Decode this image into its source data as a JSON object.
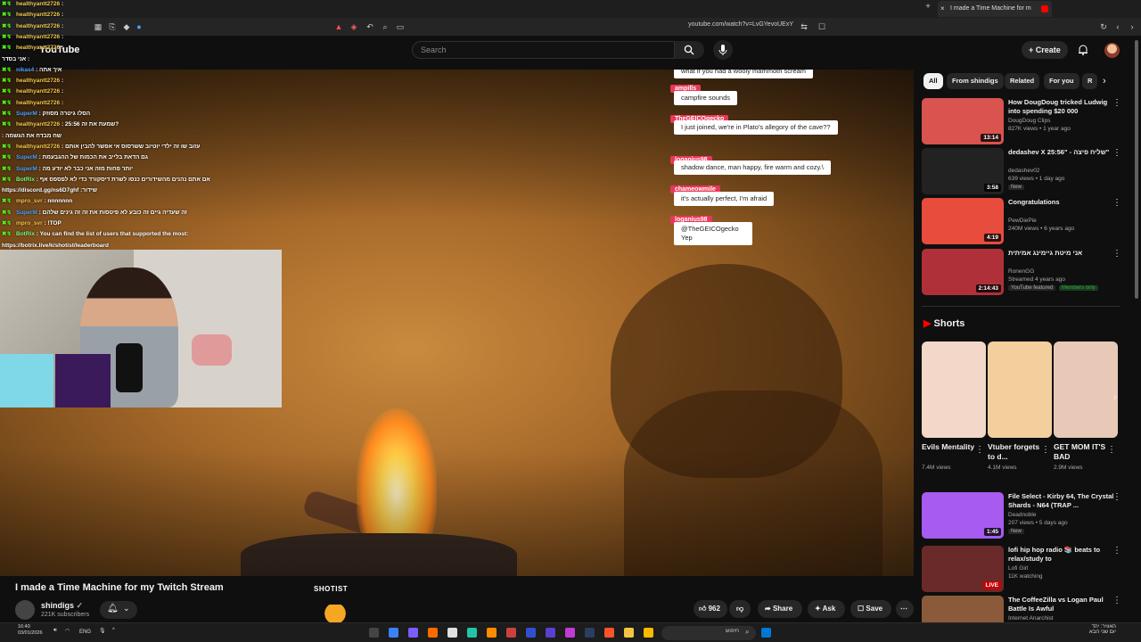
{
  "browser": {
    "tab_title": "I made a Time Machine for m",
    "tab_close": "×",
    "new_tab": "+",
    "url": "youtube.com/watch?v=LvGYevoUExY"
  },
  "youtube": {
    "logo": "YouTube",
    "search_placeholder": "Search",
    "create_label": "Create"
  },
  "chat_overlay": [
    {
      "user": "healthyantt2726",
      "msg": ":",
      "color": "yellow"
    },
    {
      "user": "healthyantt2726",
      "msg": ":",
      "color": "yellow"
    },
    {
      "user": "healthyantt2726",
      "msg": ":",
      "color": "yellow"
    },
    {
      "user": "healthyantt2726",
      "msg": ":",
      "color": "yellow"
    },
    {
      "user": "healthyantt2726",
      "msg": ":",
      "color": "yellow"
    },
    {
      "user": "",
      "msg": "אני בסדר :",
      "color": "yellow"
    },
    {
      "user": "nikas4",
      "msg": ": איך אתה",
      "color": "blue"
    },
    {
      "user": "healthyantt2726",
      "msg": ":",
      "color": "yellow"
    },
    {
      "user": "healthyantt2726",
      "msg": ":",
      "color": "yellow"
    },
    {
      "user": "healthyantt2726",
      "msg": ":",
      "color": "yellow"
    },
    {
      "user": "SuperM",
      "msg": ": הסלו גיטרה מסוזק",
      "color": "blue"
    },
    {
      "user": "healthyantt2726",
      "msg": ": 25:56 שמעת את זה?",
      "color": "yellow"
    },
    {
      "user": "",
      "msg": ": שח מבדח את הגשמה",
      "color": "red"
    },
    {
      "user": "healthyantt2726",
      "msg": ": עזוב שו זה ילדי יוטיוב ששרסוס אי אפשר להבין אותם",
      "color": "yellow"
    },
    {
      "user": "SuperM",
      "msg": ": גם הדאת בלייב את הכמות של ההגבעמת",
      "color": "blue"
    },
    {
      "user": "SuperM",
      "msg": ": יותר פחות מזה אני כבר לא יודע מה",
      "color": "blue"
    },
    {
      "user": "BotRix",
      "msg": ": אם אתם נהנים מהשידורים כנסו לשרת דיסקורד כדי לא לפספס אף",
      "color": "green"
    },
    {
      "user": "",
      "msg": "https://discord.gg/ns6D7ghf :שידור",
      "color": "yellow"
    },
    {
      "user": "mpro_svr",
      "msg": ": nnnnnnn",
      "color": "yellow"
    },
    {
      "user": "SuperM",
      "msg": ": זה שעדיה גיים זה כובע לא פיטסות את זה זה גינים שלהם",
      "color": "blue"
    },
    {
      "user": "mpro_svr",
      "msg": ": !TOP",
      "color": "yellow"
    },
    {
      "user": "BotRix",
      "msg": ": You can find the list of users that supported the most:",
      "color": "green"
    },
    {
      "user": "",
      "msg": "https://botrix.live/k/shotist/leaderboard",
      "color": "yellow"
    }
  ],
  "game_chat": [
    {
      "name": "",
      "msg": "what if you had a wooly mammoth scream"
    },
    {
      "name": "ampills",
      "msg": "campfire sounds"
    },
    {
      "name": "TheGEICOgecko",
      "msg": "I just joined, we're in Plato's allegory of the cave??"
    },
    {
      "name": "loganius98",
      "msg": "shadow dance, man happy, fire warm and cozy.\\"
    },
    {
      "name": "chameowmile",
      "msg": "it's actually perfect, I'm afraid"
    },
    {
      "name": "loganius98",
      "msg": "@TheGEICOgecko Yep"
    }
  ],
  "overlay_label": "SHOTIST",
  "video": {
    "title": "I made a Time Machine for my Twitch Stream",
    "channel": "shindigs",
    "subscribers": "221K subscribers",
    "likes": "962",
    "share": "Share",
    "ask": "Ask",
    "save": "Save"
  },
  "chips": [
    "All",
    "From shindigs",
    "Related",
    "For you",
    "R"
  ],
  "recommendations": [
    {
      "title": "How DougDoug tricked Ludwig into spending $20 000",
      "channel": "DougDoug Clips",
      "meta": "827K views • 1 year ago",
      "duration": "13:14",
      "badge": ""
    },
    {
      "title": "dedashev X שליח פיצה - \"25:56\"",
      "channel": "dedashev02",
      "meta": "639 views • 1 day ago",
      "duration": "3:58",
      "badge": "New"
    },
    {
      "title": "Congratulations",
      "channel": "PewDiePie",
      "meta": "240M views • 6 years ago",
      "duration": "4:19",
      "badge": ""
    },
    {
      "title": "אני מיטת גיימינג אמיתית",
      "channel": "RonenGG",
      "meta": "Streamed 4 years ago",
      "duration": "2:14:43",
      "badge": "YouTube featured",
      "badge2": "Members only"
    }
  ],
  "shorts": {
    "heading": "Shorts",
    "items": [
      {
        "title": "Evils Mentality",
        "views": "7.4M views"
      },
      {
        "title": "Vtuber forgets to d...",
        "views": "4.1M views"
      },
      {
        "title": "GET MOM IT'S BAD",
        "views": "2.9M views"
      }
    ]
  },
  "recommendations2": [
    {
      "title": "File Select - Kirby 64, The Crystal Shards - N64 (TRAP ...",
      "channel": "Deadnoble",
      "meta": "207 views • 5 days ago",
      "duration": "1:45",
      "badge": "New"
    },
    {
      "title": "lofi hip hop radio 📚 beats to relax/study to",
      "channel": "Lofi Girl",
      "meta": "11K watching",
      "duration": "LIVE",
      "badge": ""
    },
    {
      "title": "The CoffeeZilla vs Logan Paul Battle Is Awful",
      "channel": "Internet Anarchist",
      "meta": "",
      "duration": "",
      "badge": ""
    }
  ],
  "taskbar": {
    "time": "16:40",
    "date": "03/01/2026",
    "lang": "ENG",
    "search_text": "חיפוש",
    "notify": "האוויר: יהד",
    "notify2": "יום שני הבא"
  }
}
